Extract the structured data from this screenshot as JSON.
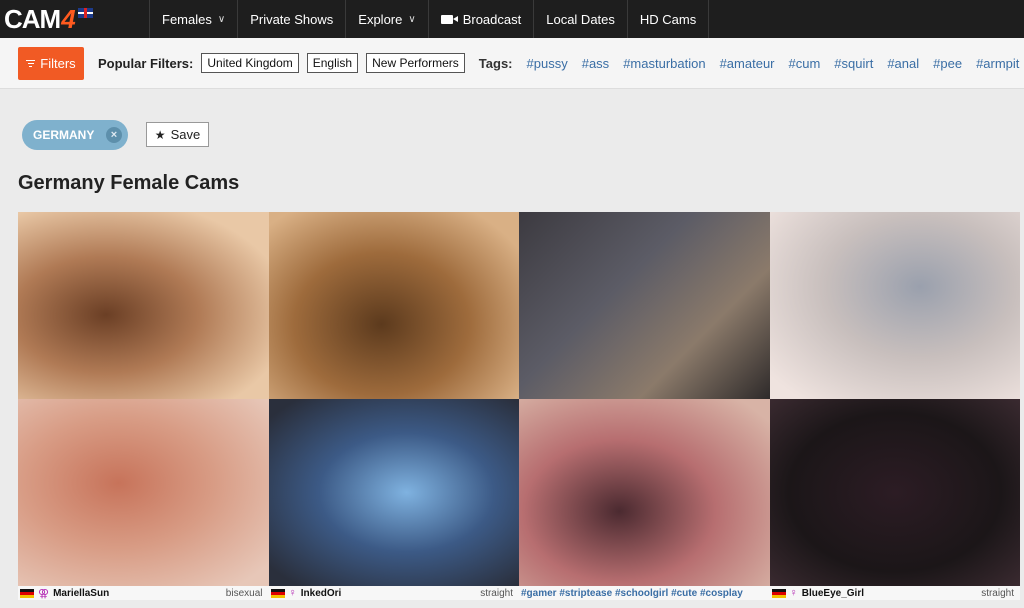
{
  "header": {
    "logo_text": "CAM",
    "logo_number": "4",
    "nav": [
      {
        "label": "Females",
        "dropdown": true
      },
      {
        "label": "Private Shows"
      },
      {
        "label": "Explore",
        "dropdown": true
      },
      {
        "label": "Broadcast",
        "icon": "video-camera-icon"
      },
      {
        "label": "Local Dates"
      },
      {
        "label": "HD Cams"
      }
    ]
  },
  "filterbar": {
    "filters_label": "Filters",
    "popular_label": "Popular Filters:",
    "chips": [
      "United Kingdom",
      "English",
      "New Performers"
    ],
    "tags_label": "Tags:",
    "tags": [
      "#pussy",
      "#ass",
      "#masturbation",
      "#amateur",
      "#cum",
      "#squirt",
      "#anal",
      "#pee",
      "#armpit"
    ]
  },
  "active_filter": {
    "label": "GERMANY",
    "remove_symbol": "×"
  },
  "save": {
    "label": "Save",
    "icon": "star-icon"
  },
  "page_title": "Germany Female Cams",
  "captions": [
    {
      "name": "MariellaSun",
      "orientation": "bisexual",
      "flag": "de-flag-icon",
      "gender_icon": "female-symbol-icon"
    },
    {
      "name": "InkedOri",
      "orientation": "straight",
      "flag": "de-flag-icon",
      "gender_icon": "female-symbol-icon"
    },
    {
      "tagline": "#gamer #striptease #schoolgirl #cute #cosplay"
    },
    {
      "name": "BlueEye_Girl",
      "orientation": "straight",
      "flag": "de-flag-icon",
      "gender_icon": "female-symbol-icon"
    }
  ],
  "colors": {
    "accent": "#f15a24",
    "nav_bg": "#1e1e1e",
    "tag_link": "#3a6ea5",
    "active_filter_bg": "#7fb1cd"
  }
}
